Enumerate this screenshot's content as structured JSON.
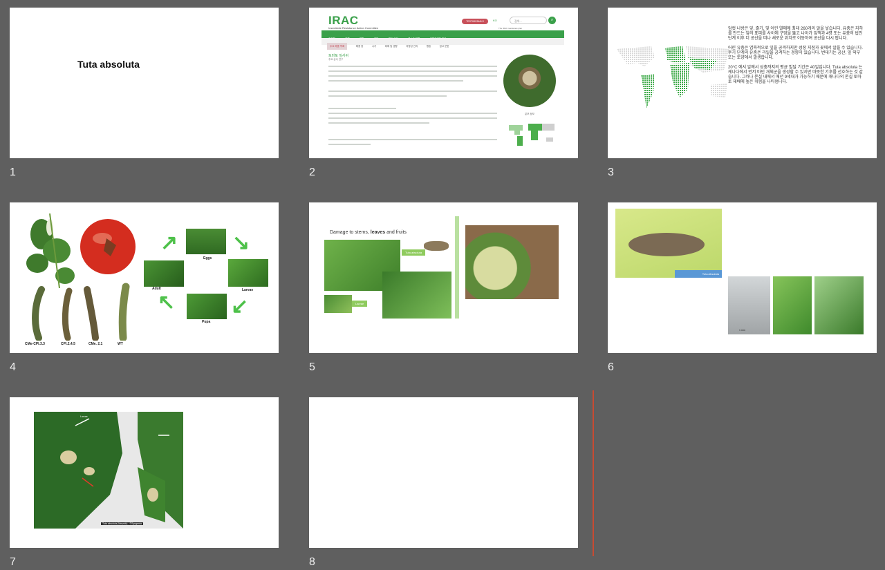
{
  "slides": [
    {
      "number": "1",
      "title": "Tuta absoluta"
    },
    {
      "number": "2",
      "logo": "IRAC",
      "logo_sub": "Insecticide Resistance Action Committee",
      "pill": "TESTIMONIALS",
      "lang": "KO",
      "search_placeholder": "검색...",
      "tagline": "The IRAC resistance plan",
      "nav": [
        "호회원",
        "회원",
        "해충",
        "작물",
        "행동 요인",
        "테스트 방법",
        "이해관계자 제공"
      ],
      "subnav": [
        "주요 해충 목록",
        "해충 종",
        "시기",
        "피해 및 영향",
        "저항성 관리",
        "행동",
        "참고 문헌"
      ],
      "heading": "토마토 잎사귀",
      "subheading": "주요 급속 연구",
      "map_caption": "분포 정보"
    },
    {
      "number": "3",
      "paragraphs": [
        "암컷 나방은 잎, 줄기, 및 어린 열매에 최대 260개의 알을 낳습니다. 유충은 지하를 만드는 잎의 표피를 사이에 구멍을 뚫고 나아가 잎맥과 4령 또는 유충의 법인 단계 이후 더 공산을 떠나 새로운 위치로 이동하여 공산을 다시 팝니다.",
        "어린 유충은 엽육적으로 잎을 공격하지만 성장 지점과 꽃에서 알을 수 있습니다. 후기 단계의 유충은 과일을 공격하는 경향이 있습니다. 번데기는 공산, 잎 외부 또는 토양에서 발생합니다.",
        "20°C 에서 알에서 성충까지의 평균 발달 기간은 40일입니다. Tuta absoluta 는 케나다에서 먼저 마인 개체군을 생성할 수 있지만 따뜻한 기후를 선호하는 것 같습니다. 그러나 온실 내에서 매년 9세대가 가능하기 때문에 캐나다의 온실 토마토 재배에 높은 위험을 나타냅니다."
      ]
    },
    {
      "number": "4",
      "stages": [
        "Eggs",
        "Larvae",
        "Pupa",
        "Adult"
      ],
      "larvae_labels": [
        "CMe-CPI.3.3",
        "CPI.2.4.5",
        "CMe. 2.1",
        "WT"
      ]
    },
    {
      "number": "5",
      "title_parts": [
        "Damage to stems, ",
        "leaves",
        " and fruits"
      ],
      "tag_adult": "Tuta absoluta",
      "tag_larvae": "Larvae"
    },
    {
      "number": "6",
      "tag": "Tuta Absoluta",
      "scale": "1 mm"
    },
    {
      "number": "7",
      "label_top": "Larvae",
      "caption": "Tuta absoluta (Meyrick) - ©Syngenta"
    },
    {
      "number": "8"
    }
  ]
}
